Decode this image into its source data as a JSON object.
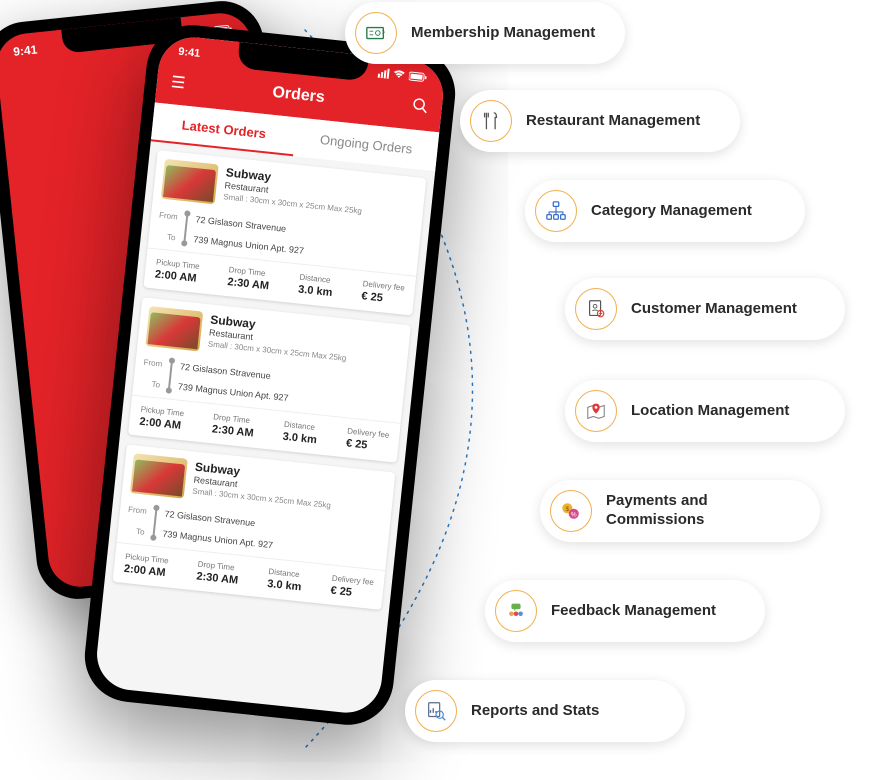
{
  "phone": {
    "time": "9:41",
    "header_title": "Orders",
    "tabs": {
      "active": "Latest Orders",
      "inactive": "Ongoing Orders"
    },
    "orders": [
      {
        "name": "Subway",
        "type": "Restaurant",
        "dims": "Small : 30cm x 30cm x 25cm Max 25kg",
        "from_lbl": "From",
        "to_lbl": "To",
        "from": "72 Gislason Stravenue",
        "to": "739 Magnus Union Apt. 927",
        "pickup_lbl": "Pickup Time",
        "pickup": "2:00 AM",
        "drop_lbl": "Drop Time",
        "drop": "2:30 AM",
        "dist_lbl": "Distance",
        "dist": "3.0 km",
        "fee_lbl": "Delivery fee",
        "fee": "€ 25"
      },
      {
        "name": "Subway",
        "type": "Restaurant",
        "dims": "Small : 30cm x 30cm x 25cm Max 25kg",
        "from_lbl": "From",
        "to_lbl": "To",
        "from": "72 Gislason Stravenue",
        "to": "739 Magnus Union Apt. 927",
        "pickup_lbl": "Pickup Time",
        "pickup": "2:00 AM",
        "drop_lbl": "Drop Time",
        "drop": "2:30 AM",
        "dist_lbl": "Distance",
        "dist": "3.0 km",
        "fee_lbl": "Delivery fee",
        "fee": "€ 25"
      },
      {
        "name": "Subway",
        "type": "Restaurant",
        "dims": "Small : 30cm x 30cm x 25cm Max 25kg",
        "from_lbl": "From",
        "to_lbl": "To",
        "from": "72 Gislason Stravenue",
        "to": "739 Magnus Union Apt. 927",
        "pickup_lbl": "Pickup Time",
        "pickup": "2:00 AM",
        "drop_lbl": "Drop Time",
        "drop": "2:30 AM",
        "dist_lbl": "Distance",
        "dist": "3.0 km",
        "fee_lbl": "Delivery fee",
        "fee": "€ 25"
      }
    ]
  },
  "features": [
    "Membership Management",
    "Restaurant Management",
    "Category Management",
    "Customer Management",
    "Location Management",
    "Payments and Commissions",
    "Feedback Management",
    "Reports and Stats"
  ]
}
